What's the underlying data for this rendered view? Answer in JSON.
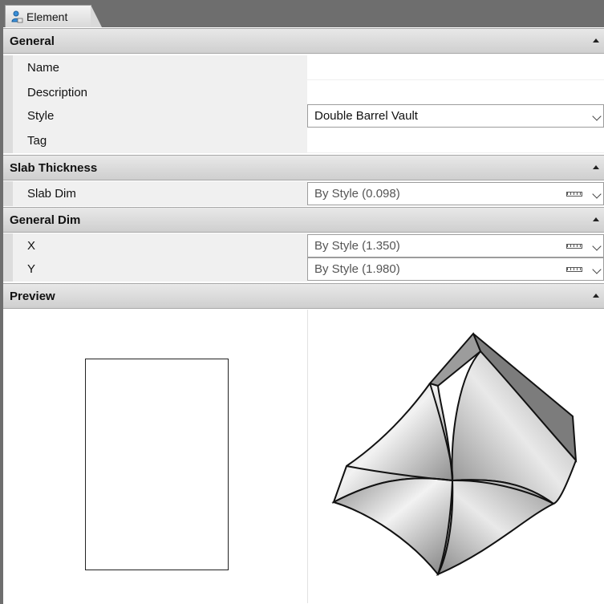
{
  "tab": {
    "label": "Element",
    "icon": "element-icon"
  },
  "sections": {
    "general": {
      "title": "General",
      "rows": [
        {
          "label": "Name",
          "value": ""
        },
        {
          "label": "Description",
          "value": ""
        },
        {
          "label": "Style",
          "value": "Double Barrel Vault"
        },
        {
          "label": "Tag",
          "value": ""
        }
      ]
    },
    "slab": {
      "title": "Slab Thickness",
      "rows": [
        {
          "label": "Slab Dim",
          "value": "By Style (0.098)"
        }
      ]
    },
    "dim": {
      "title": "General Dim",
      "rows": [
        {
          "label": "X",
          "value": "By Style (1.350)"
        },
        {
          "label": "Y",
          "value": "By Style (1.980)"
        }
      ]
    },
    "preview": {
      "title": "Preview"
    }
  },
  "colors": {
    "tabbar": "#6e6e6e",
    "header": "#dcdcdc",
    "label_bg": "#f0f0f0"
  }
}
